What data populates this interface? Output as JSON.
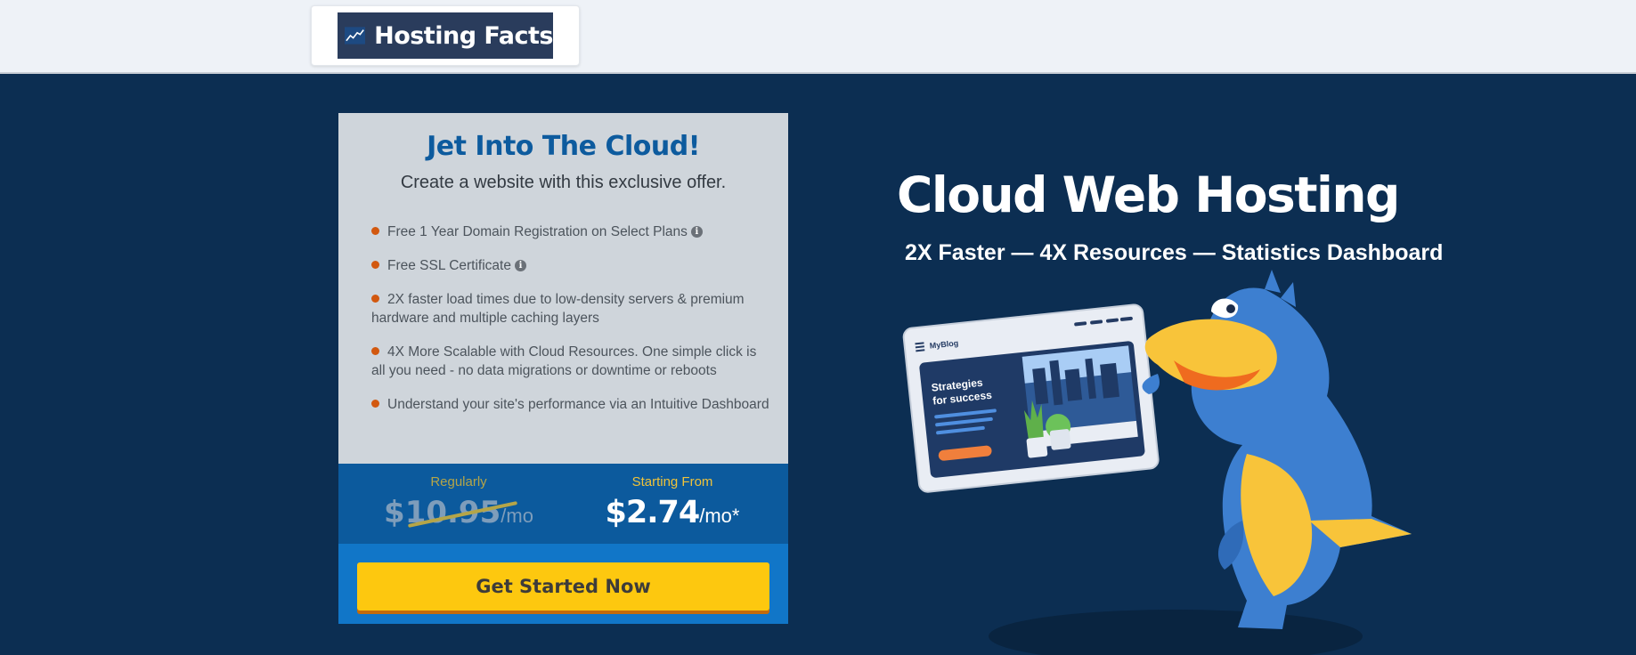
{
  "header": {
    "logo_text": "Hosting Facts",
    "logo_icon": "chart-trend-icon"
  },
  "offer_card": {
    "title": "Jet Into The Cloud!",
    "subtitle": "Create a website with this exclusive offer.",
    "features": [
      {
        "text": "Free 1 Year Domain Registration on Select Plans",
        "has_info_icon": true
      },
      {
        "text": "Free SSL Certificate",
        "has_info_icon": true
      },
      {
        "text": "2X faster load times due to low-density servers & premium hardware and multiple caching layers",
        "has_info_icon": false
      },
      {
        "text": "4X More Scalable with Cloud Resources. One simple click is all you need - no data migrations or downtime or reboots",
        "has_info_icon": false
      },
      {
        "text": "Understand your site's performance via an Intuitive Dashboard",
        "has_info_icon": false
      }
    ],
    "pricing": {
      "regular_label": "Regularly",
      "regular_price": "$10.95",
      "regular_unit": "/mo",
      "start_label": "Starting From",
      "start_price": "$2.74",
      "start_unit": "/mo*"
    },
    "cta_label": "Get Started Now"
  },
  "hero": {
    "title": "Cloud Web Hosting",
    "subtitle": "2X Faster — 4X Resources — Statistics Dashboard",
    "illustration": {
      "blog_name": "MyBlog",
      "headline_line1": "Strategies",
      "headline_line2": "for success"
    }
  },
  "colors": {
    "page_background": "#0c2e52",
    "card_background": "#cfd5db",
    "card_title": "#0d5b9e",
    "bullet": "#d2580f",
    "pricing_band": "#0c5a9d",
    "cta_band": "#1176c8",
    "cta_button": "#fdc80f",
    "mascot_blue": "#3d7fd0",
    "mascot_yellow": "#f8c43a"
  }
}
